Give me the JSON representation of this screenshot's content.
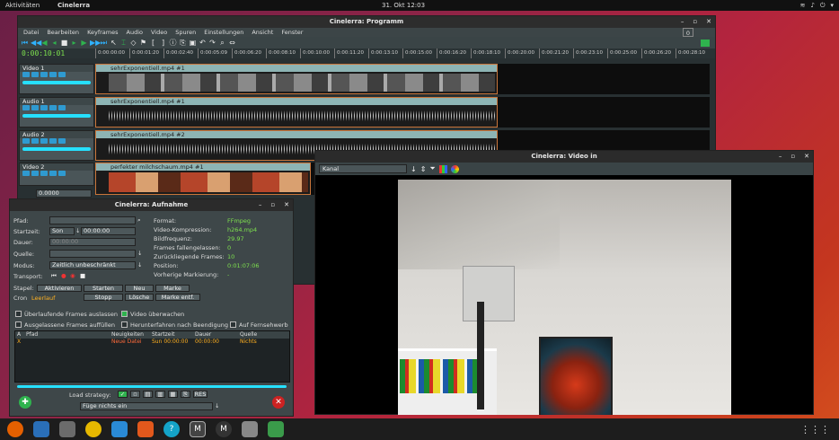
{
  "topbar": {
    "activities": "Aktivitäten",
    "app": "Cinelerra",
    "clock": "31. Okt 12:03",
    "tray": [
      "≋",
      "♪",
      "⏻",
      "▾"
    ]
  },
  "program": {
    "title": "Cinelerra: Programm",
    "menu": [
      "Datei",
      "Bearbeiten",
      "Keyframes",
      "Audio",
      "Video",
      "Spuren",
      "Einstellungen",
      "Ansicht",
      "Fenster"
    ],
    "menu_right": "0",
    "timecode": "0:00:10:01",
    "ruler": [
      "0:00:00:00",
      "0:00:01:20",
      "0:00:02:40",
      "0:00:05:09",
      "0:00:06:20",
      "0:00:08:10",
      "0:00:10:00",
      "0:00:11:20",
      "0:00:13:10",
      "0:00:15:00",
      "0:00:16:20",
      "0:00:18:10",
      "0:00:20:00",
      "0:00:21:20",
      "0:00:23:10",
      "0:00:25:00",
      "0:00:26:20",
      "0:00:28:10"
    ],
    "tracks": [
      {
        "name": "Video 1",
        "clip": "sehrExponentiell.mp4 #1",
        "type": "video"
      },
      {
        "name": "Audio 1",
        "clip": "sehrExponentiell.mp4 #1",
        "type": "audio"
      },
      {
        "name": "Audio 2",
        "clip": "sehrExponentiell.mp4 #2",
        "type": "audio"
      },
      {
        "name": "Video 2",
        "clip": "perfekter milchschaum.mp4 #1",
        "type": "video2"
      }
    ],
    "bottom_field": "0.0000"
  },
  "video_in": {
    "title": "Cinelerra: Video in",
    "channel": "Kanal"
  },
  "recording": {
    "title": "Cinelerra: Aufnahme",
    "labels": {
      "pfad": "Pfad:",
      "startzeit": "Startzeit:",
      "dauer": "Dauer:",
      "quelle": "Quelle:",
      "modus": "Modus:",
      "transport": "Transport:",
      "stapel": "Stapel:",
      "cron": "Cron"
    },
    "start_day": "Son",
    "start_time": "00:00:00",
    "dauer_value": "00:00:00",
    "modus_value": "Zeitlich unbeschränkt",
    "cron_status": "Leerlauf",
    "stapel_buttons": [
      "Aktivieren",
      "Starten",
      "Neu",
      "Marke"
    ],
    "cron_buttons": [
      "Stopp",
      "Lösche",
      "Marke entf."
    ],
    "info": [
      {
        "label": "Format:",
        "value": "FFmpeg"
      },
      {
        "label": "Video-Kompression:",
        "value": "h264.mp4"
      },
      {
        "label": "Bildfrequenz:",
        "value": "29.97"
      },
      {
        "label": "Frames fallengelassen:",
        "value": "0"
      },
      {
        "label": "Zurückliegende Frames:",
        "value": "10"
      },
      {
        "label": "Position:",
        "value": "0:01:07:06"
      },
      {
        "label": "Vorherige Markierung:",
        "value": "-"
      }
    ],
    "checks": [
      {
        "label": "Überlaufende Frames auslassen",
        "on": false
      },
      {
        "label": "Video überwachen",
        "on": true
      },
      {
        "label": "Ausgelassene Frames auffüllen",
        "on": false
      },
      {
        "label": "Herunterfahren nach Beendigung",
        "on": false
      },
      {
        "label": "Auf Fernsehwerb",
        "on": false
      }
    ],
    "list_headers": [
      "A",
      "Pfad",
      "Neuigkeiten",
      "Startzeit",
      "Dauer",
      "Quelle"
    ],
    "list_row": [
      "X",
      "",
      "Neue Datei",
      "Sun 00:00:00",
      "00:00:00",
      "Nichts"
    ],
    "load_strategy_label": "Load strategy:",
    "load_strategy_value": "Füge nichts ein",
    "res_button": "RES"
  },
  "dock_icons": [
    "firefox-icon",
    "mail-icon",
    "files-icon",
    "rhythmbox-icon",
    "writer-icon",
    "software-icon",
    "help-icon",
    "cinelerra-icon",
    "cinelerra2-icon",
    "disk-icon",
    "trash-icon"
  ],
  "colors": {
    "accent_green": "#7de04e",
    "clip_border": "#c9753a",
    "clip_title": "#8db4b4",
    "recording_orange": "#ffb020"
  }
}
